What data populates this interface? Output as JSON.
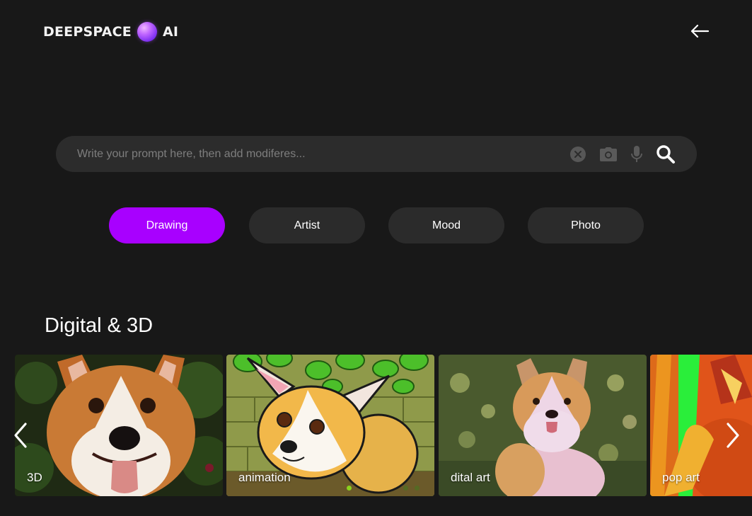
{
  "header": {
    "brand_left": "DEEPSPACE",
    "brand_right": "AI",
    "back_icon": "arrow-left-icon"
  },
  "search": {
    "placeholder": "Write your prompt here, then add modiferes...",
    "value": "",
    "icons": [
      "clear-icon",
      "camera-icon",
      "microphone-icon",
      "search-icon"
    ]
  },
  "tabs": [
    {
      "label": "Drawing",
      "active": true
    },
    {
      "label": "Artist",
      "active": false
    },
    {
      "label": "Mood",
      "active": false
    },
    {
      "label": "Photo",
      "active": false
    }
  ],
  "section": {
    "title": "Digital & 3D",
    "cards": [
      {
        "label": "3D"
      },
      {
        "label": "animation"
      },
      {
        "label": "dital art"
      },
      {
        "label": "pop art"
      }
    ],
    "nav": {
      "prev_icon": "chevron-left-icon",
      "next_icon": "chevron-right-icon"
    }
  },
  "colors": {
    "background": "#181818",
    "surface": "#2b2b2b",
    "accent": "#a800ff"
  }
}
